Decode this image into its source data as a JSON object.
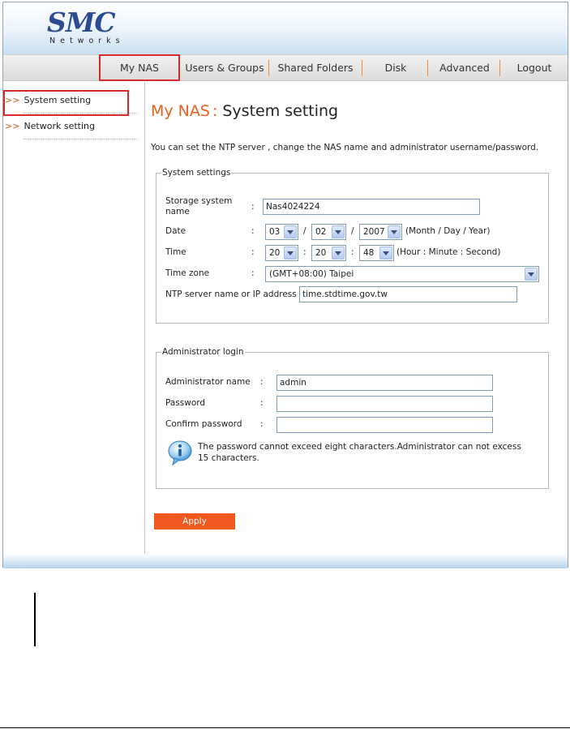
{
  "logo": {
    "main": "SMC",
    "sub": "Networks"
  },
  "nav": [
    {
      "label": "My NAS"
    },
    {
      "label": "Users & Groups"
    },
    {
      "label": "Shared Folders"
    },
    {
      "label": "Disk"
    },
    {
      "label": "Advanced"
    },
    {
      "label": "Logout"
    }
  ],
  "sidebar": [
    {
      "arrows": ">>",
      "label": "System setting"
    },
    {
      "arrows": ">>",
      "label": "Network setting"
    }
  ],
  "page": {
    "title_prefix": "My NAS",
    "title_colon": ":",
    "title": "System setting",
    "description": "You can set the NTP server , change the NAS name and administrator username/password."
  },
  "system_settings": {
    "legend": "System settings",
    "storage_label": "Storage system name",
    "storage_value": "Nas4024224",
    "date_label": "Date",
    "date_month": "03",
    "date_day": "02",
    "date_year": "2007",
    "date_sep": "/",
    "date_hint": "(Month / Day / Year)",
    "time_label": "Time",
    "time_hour": "20",
    "time_minute": "20",
    "time_second": "48",
    "time_sep": ":",
    "time_hint": "(Hour : Minute : Second)",
    "timezone_label": "Time zone",
    "timezone_value": "(GMT+08:00) Taipei",
    "ntp_label": "NTP server name or IP address :",
    "ntp_value": "time.stdtime.gov.tw",
    "colon": ":"
  },
  "admin": {
    "legend": "Administrator login",
    "name_label": "Administrator name",
    "name_value": "admin",
    "password_label": "Password",
    "password_value": "",
    "confirm_label": "Confirm password",
    "confirm_value": "",
    "note": "The password cannot exceed eight characters.Administrator can not excess 15 characters.",
    "colon": ":"
  },
  "apply_label": "Apply",
  "colors": {
    "accent": "#e8601c",
    "brand": "#2b4b93",
    "highlight_box": "#d92b2b"
  }
}
